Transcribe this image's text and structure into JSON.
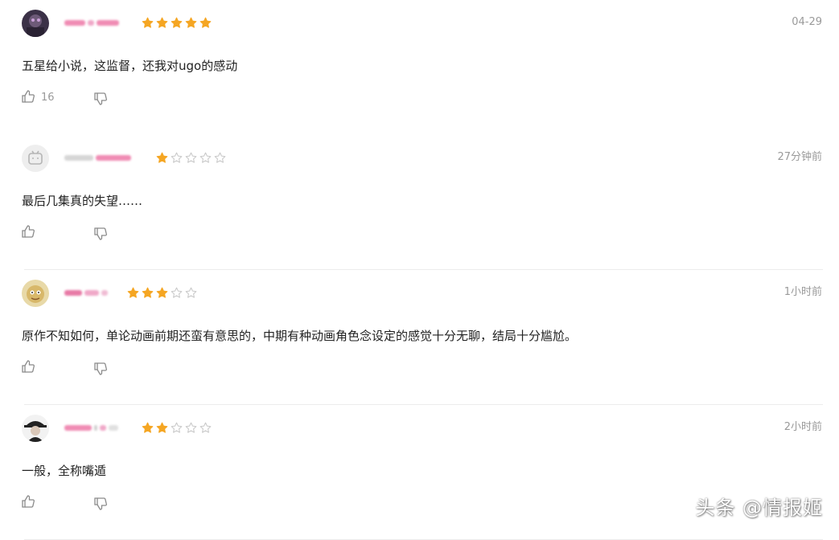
{
  "colors": {
    "star_filled": "#f5a623",
    "star_empty": "#c8c8c8",
    "text_primary": "#222222",
    "text_secondary": "#9a9a9a",
    "username_blur": "#f08cb4",
    "divider": "#ececec"
  },
  "icons": {
    "like": "thumbs-up-icon",
    "dislike": "thumbs-down-icon",
    "star": "star-icon"
  },
  "reviews": [
    {
      "rating": 5,
      "time": "04-29",
      "content": "五星给小说，这监督，还我对ugo的感动",
      "likes": "16"
    },
    {
      "rating": 1,
      "time": "27分钟前",
      "content": "最后几集真的失望……",
      "likes": ""
    },
    {
      "rating": 3,
      "time": "1小时前",
      "content": "原作不知如何，单论动画前期还蛮有意思的，中期有种动画角色念设定的感觉十分无聊，结局十分尴尬。",
      "likes": ""
    },
    {
      "rating": 2,
      "time": "2小时前",
      "content": "一般，全称嘴遁",
      "likes": ""
    }
  ],
  "watermark": "头条 @情报姬"
}
